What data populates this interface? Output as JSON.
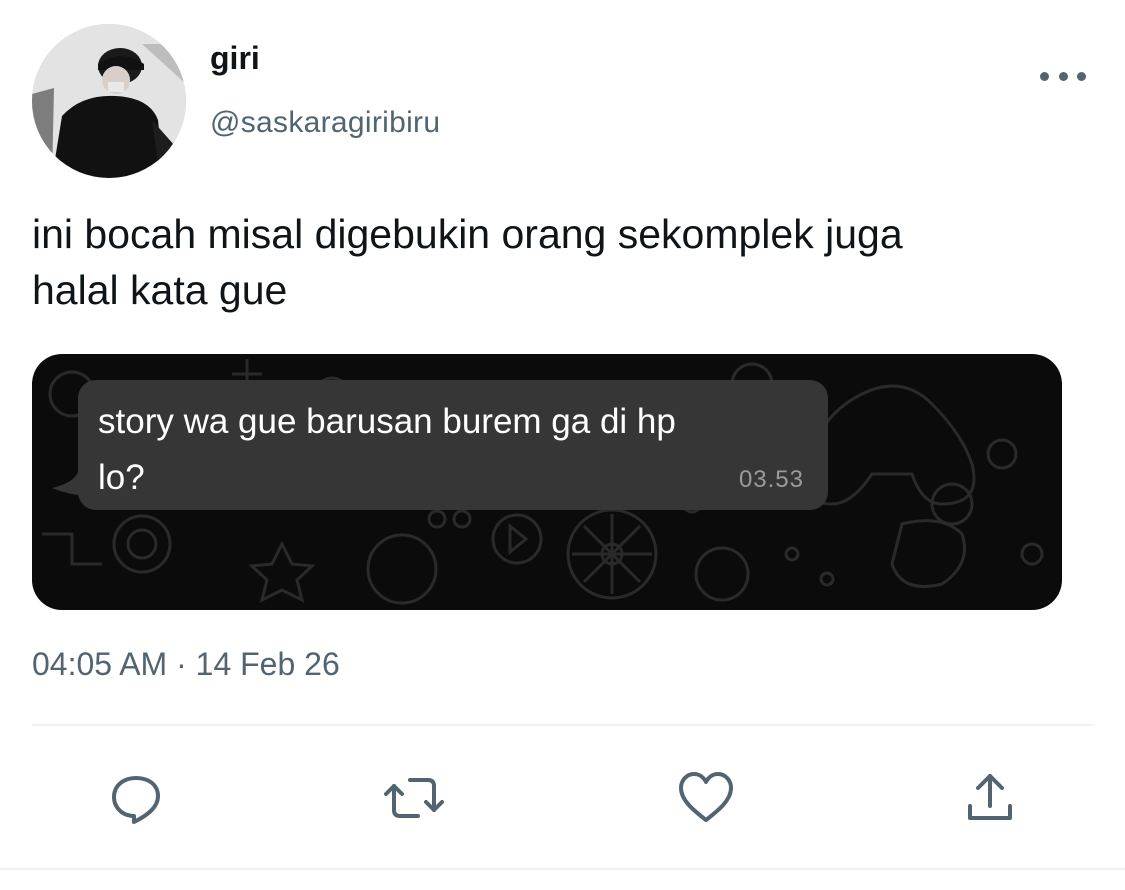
{
  "tweet": {
    "display_name": "giri",
    "handle": "@saskaragiribiru",
    "text_line1": "ini bocah misal digebukin orang sekomplek juga",
    "text_line2": "halal kata gue",
    "timestamp": "04:05 AM · 14 Feb 26"
  },
  "media": {
    "message_text_line1": "story wa gue barusan burem ga di hp",
    "message_text_line2": "lo?",
    "message_time": "03.53"
  },
  "actions": [
    {
      "name": "reply",
      "icon": "speech-bubble-icon"
    },
    {
      "name": "retweet",
      "icon": "retweet-arrows-icon"
    },
    {
      "name": "like",
      "icon": "heart-icon"
    },
    {
      "name": "share",
      "icon": "upload-arrow-icon"
    }
  ],
  "colors": {
    "text": "#0f1419",
    "secondary": "#536471",
    "divider": "#eff3f4",
    "chat_background": "#0b0b0b",
    "bubble": "#363636",
    "bubble_time": "#9b9b9b"
  }
}
